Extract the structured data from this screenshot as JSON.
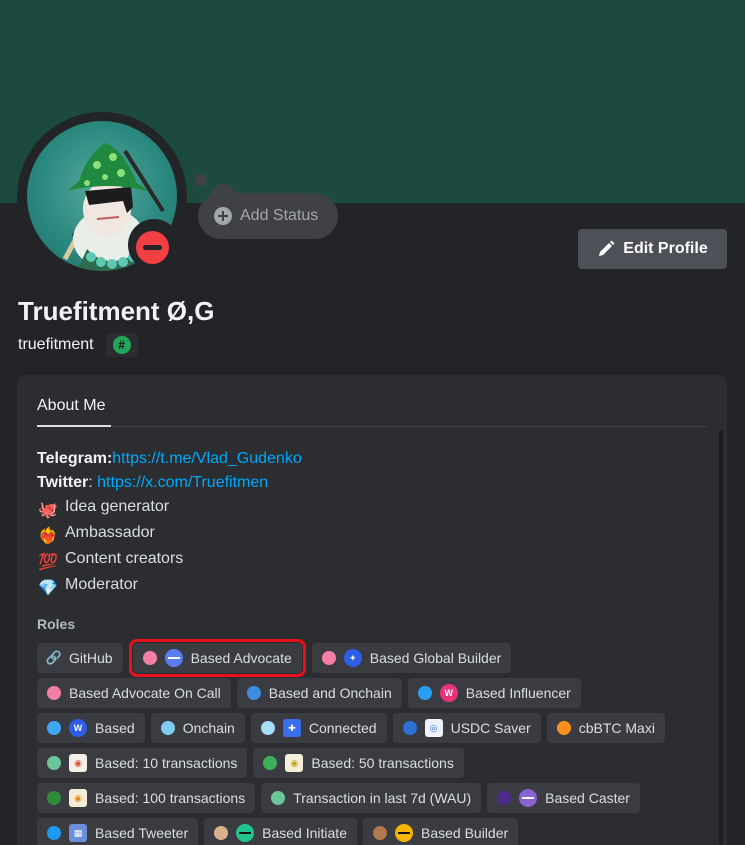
{
  "profile": {
    "display_name": "Truefitment Ø,G",
    "username": "truefitment",
    "add_status_label": "Add Status",
    "edit_profile_label": "Edit Profile",
    "status": "do-not-disturb",
    "badge_glyph": "#"
  },
  "tabs": {
    "about_me": "About Me"
  },
  "bio": {
    "telegram_label": "Telegram",
    "telegram_sep": ":",
    "telegram_link": "https://t.me/Vlad_Gudenko",
    "twitter_label": "Twitter",
    "twitter_sep": ": ",
    "twitter_link": "https://x.com/Truefitmen",
    "lines": [
      {
        "icon": "octopus-icon",
        "glyph": "🐙",
        "text": "Idea generator"
      },
      {
        "icon": "fire-heart-icon",
        "glyph": "❤️‍🔥",
        "text": "Ambassador"
      },
      {
        "icon": "hundred-icon",
        "glyph": "💯",
        "text": "Content creators"
      },
      {
        "icon": "gem-icon",
        "glyph": "💎",
        "text": "Moderator"
      }
    ]
  },
  "roles_title": "Roles",
  "roles": {
    "row1": [
      {
        "label": "GitHub",
        "dot": "",
        "icon": "link-icon"
      },
      {
        "label": "Based Advocate",
        "dot": "#f47fa4",
        "icon": "based-advocate-icon",
        "icon_color": "#5b7cf0",
        "highlighted": true
      },
      {
        "label": "Based Global Builder",
        "dot": "#f47fa4",
        "icon": "globe-builder-icon",
        "icon_color": "#2f5ee8"
      }
    ],
    "row2": [
      {
        "label": "Based Advocate On Call",
        "dot": "#f47fa4"
      },
      {
        "label": "Based and Onchain",
        "dot": "#3a8de0"
      },
      {
        "label": "Based Influencer",
        "dot": "#2a9df4",
        "icon": "influencer-icon",
        "icon_color": "#e8337a"
      }
    ],
    "row3": [
      {
        "label": "Based",
        "dot": "#3ea8f4",
        "icon": "based-icon",
        "icon_color": "#2e5ce6"
      },
      {
        "label": "Onchain",
        "dot": "#7ecbf2"
      },
      {
        "label": "Connected",
        "dot": "#a8dcf7",
        "icon": "connected-icon",
        "icon_color": "#3a6ff0"
      },
      {
        "label": "USDC Saver",
        "dot": "#2d72d9",
        "icon": "usdc-icon",
        "icon_color": "#eef2ff"
      },
      {
        "label": "cbBTC Maxi",
        "dot": "#f7931a"
      }
    ],
    "row4": [
      {
        "label": "Based: 10 transactions",
        "dot": "#6cc49a",
        "icon": "tx10-icon",
        "icon_color": "#f4eee6"
      },
      {
        "label": "Based: 50 transactions",
        "dot": "#3fae5a",
        "icon": "tx50-icon",
        "icon_color": "#f4efd8"
      }
    ],
    "row5": [
      {
        "label": "Based: 100 transactions",
        "dot": "#2e8b3a",
        "icon": "tx100-icon",
        "icon_color": "#f4ecd8"
      },
      {
        "label": "Transaction in last 7d (WAU)",
        "dot": "#6cc49a"
      },
      {
        "label": "Based Caster",
        "dot": "#4b2a8c",
        "icon": "caster-icon",
        "icon_color": "#8a63d2"
      }
    ],
    "row6": [
      {
        "label": "Based Tweeter",
        "dot": "#1d9bf0",
        "icon": "tweeter-icon",
        "icon_color": "#6d8fd9"
      },
      {
        "label": "Based Initiate",
        "dot": "#d9b08c",
        "icon": "initiate-icon",
        "icon_color": "#22c38e"
      },
      {
        "label": "Based Builder",
        "dot": "#b07a4f",
        "icon": "builder-icon",
        "icon_color": "#f5b400"
      }
    ]
  }
}
